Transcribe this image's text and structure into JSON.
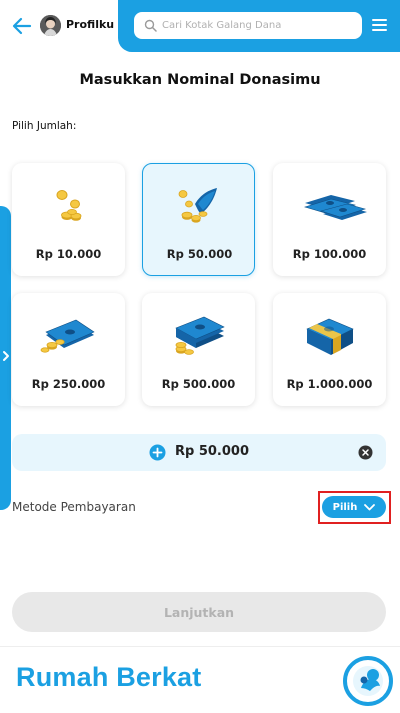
{
  "header": {
    "profile_label": "Profilku",
    "search_placeholder": "Cari Kotak Galang Dana"
  },
  "page": {
    "title": "Masukkan Nominal Donasimu",
    "amount_prompt": "Pilih Jumlah:"
  },
  "amounts": [
    {
      "label": "Rp 10.000",
      "icon": "coins-icon",
      "selected": false
    },
    {
      "label": "Rp 50.000",
      "icon": "coins-banknote-icon",
      "selected": true
    },
    {
      "label": "Rp 100.000",
      "icon": "banknotes-icon",
      "selected": false
    },
    {
      "label": "Rp 250.000",
      "icon": "banknote-coins-icon",
      "selected": false
    },
    {
      "label": "Rp 500.000",
      "icon": "cash-stack-coins-icon",
      "selected": false
    },
    {
      "label": "Rp 1.000.000",
      "icon": "cash-bundle-icon",
      "selected": false
    }
  ],
  "selected_amount": "Rp 50.000",
  "payment": {
    "label": "Metode Pembayaran",
    "button_label": "Pilih"
  },
  "continue_label": "Lanjutkan",
  "brand": "Rumah Berkat",
  "colors": {
    "accent": "#1ba0e2",
    "selected_bg": "#e7f6fd",
    "highlight_outline": "#e02020",
    "coin": "#f5c842",
    "note_dark": "#1565a8"
  }
}
